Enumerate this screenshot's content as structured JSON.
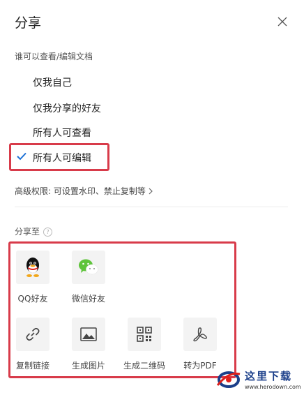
{
  "header": {
    "title": "分享",
    "close_icon": "close-icon"
  },
  "permissions": {
    "label": "谁可以查看/编辑文档",
    "options": [
      {
        "label": "仅我自己",
        "selected": false
      },
      {
        "label": "仅我分享的好友",
        "selected": false
      },
      {
        "label": "所有人可查看",
        "selected": false
      },
      {
        "label": "所有人可编辑",
        "selected": true
      }
    ],
    "advanced": "高级权限: 可设置水印、禁止复制等"
  },
  "share": {
    "label": "分享至",
    "targets": [
      {
        "label": "QQ好友",
        "icon": "qq-icon"
      },
      {
        "label": "微信好友",
        "icon": "wechat-icon"
      },
      {
        "label": "复制链接",
        "icon": "link-icon"
      },
      {
        "label": "生成图片",
        "icon": "image-icon"
      },
      {
        "label": "生成二维码",
        "icon": "qrcode-icon"
      },
      {
        "label": "转为PDF",
        "icon": "pdf-icon"
      }
    ]
  },
  "watermark": {
    "title": "这里下载",
    "url": "www.herodown.com"
  },
  "colors": {
    "accent": "#1a6fd6",
    "highlight": "#d83b4a",
    "wechat": "#5ec43a"
  }
}
